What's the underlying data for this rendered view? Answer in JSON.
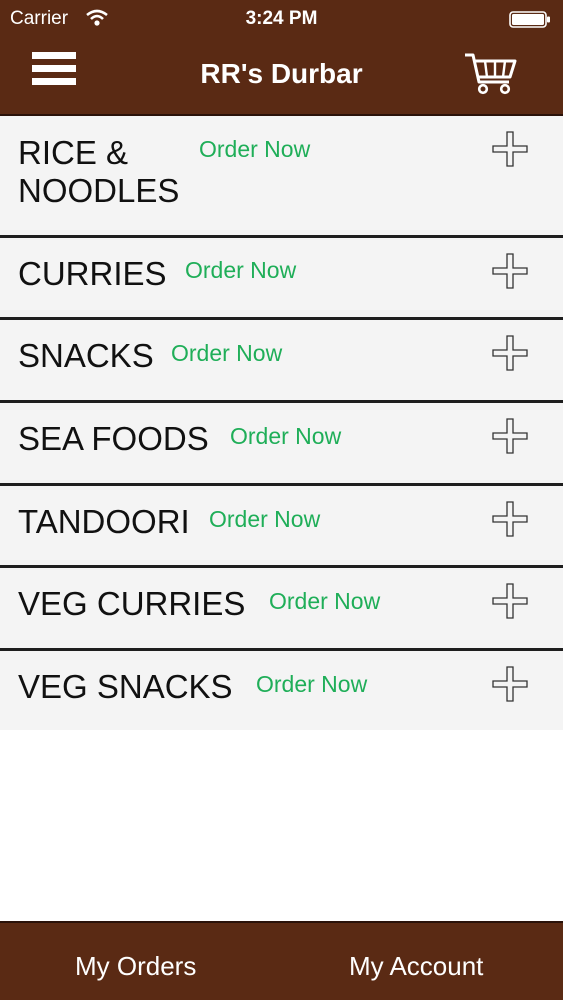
{
  "status_bar": {
    "carrier": "Carrier",
    "time": "3:24 PM"
  },
  "header": {
    "title": "RR's Durbar"
  },
  "categories": [
    {
      "name": "RICE &\nNOODLES",
      "action": "Order Now"
    },
    {
      "name": "CURRIES",
      "action": "Order Now"
    },
    {
      "name": "SNACKS",
      "action": "Order Now"
    },
    {
      "name": "SEA FOODS",
      "action": "Order Now"
    },
    {
      "name": "TANDOORI",
      "action": "Order Now"
    },
    {
      "name": "VEG CURRIES",
      "action": "Order Now"
    },
    {
      "name": "VEG SNACKS",
      "action": "Order Now"
    }
  ],
  "bottom_nav": {
    "orders": "My Orders",
    "account": "My Account"
  },
  "colors": {
    "brand": "#5a2a14",
    "accent": "#1fae58"
  },
  "icons": [
    "menu-icon",
    "cart-icon",
    "plus-icon",
    "wifi-icon",
    "battery-icon"
  ]
}
